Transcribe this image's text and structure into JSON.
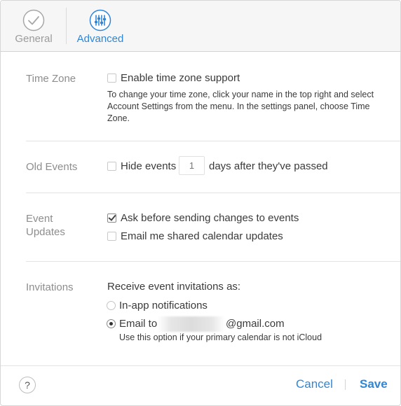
{
  "toolbar": {
    "tabs": [
      {
        "label": "General",
        "icon": "checkmark-circle-icon",
        "active": false
      },
      {
        "label": "Advanced",
        "icon": "sliders-icon",
        "active": true
      }
    ],
    "active_color": "#2f86d6",
    "inactive_color": "#9b9b9b"
  },
  "time_zone": {
    "label": "Time Zone",
    "checkbox_label": "Enable time zone support",
    "checked": false,
    "description": "To change your time zone, click your name in the top right and select Account Settings from the menu. In the settings panel, choose Time Zone."
  },
  "old_events": {
    "label": "Old Events",
    "checkbox_label": "Hide events",
    "checked": false,
    "days_placeholder": "1",
    "suffix": "days after they've passed"
  },
  "event_updates": {
    "label_line1": "Event",
    "label_line2": "Updates",
    "options": [
      {
        "label": "Ask before sending changes to events",
        "checked": true
      },
      {
        "label": "Email me shared calendar updates",
        "checked": false
      }
    ]
  },
  "invitations": {
    "label": "Invitations",
    "prompt": "Receive event invitations as:",
    "options": [
      {
        "label": "In-app notifications",
        "selected": false
      },
      {
        "label_prefix": "Email to",
        "label_suffix": "@gmail.com",
        "selected": true
      }
    ],
    "note": "Use this option if your primary calendar is not iCloud"
  },
  "footer": {
    "help_label": "?",
    "cancel_label": "Cancel",
    "save_label": "Save"
  }
}
